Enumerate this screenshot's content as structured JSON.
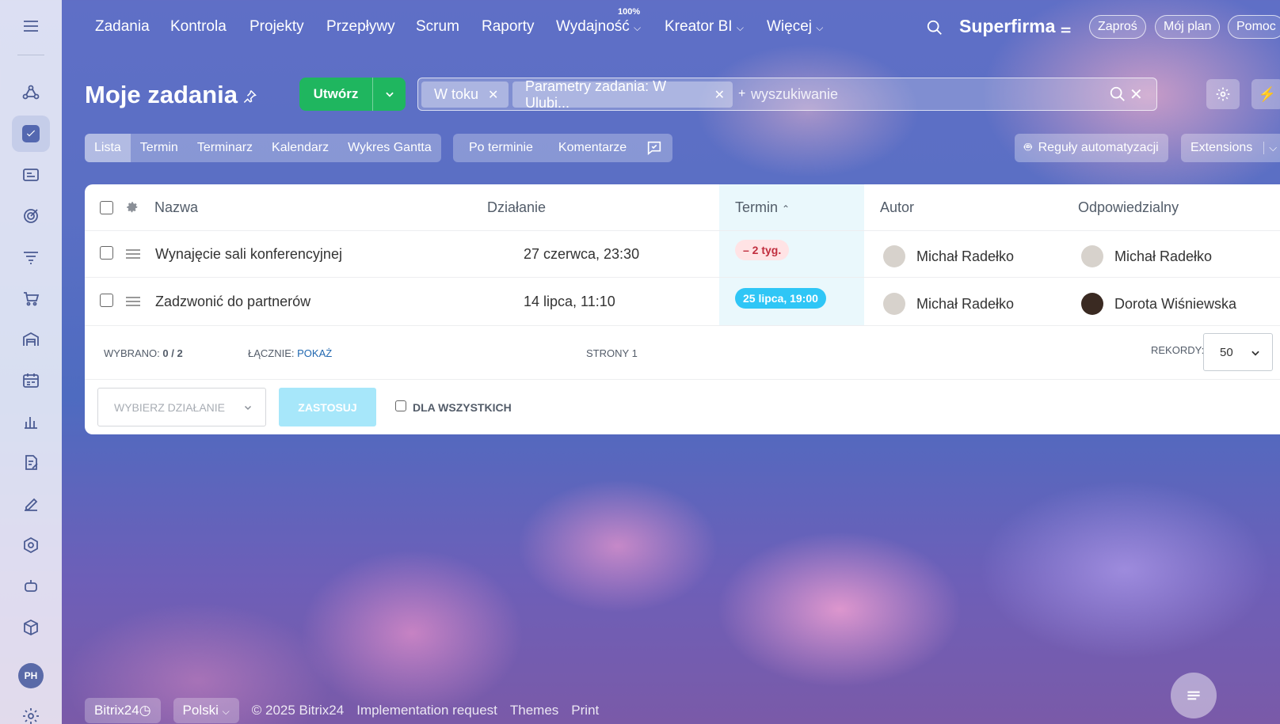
{
  "app": {
    "brand": "Superfirma"
  },
  "topnav": {
    "items": [
      "Zadania",
      "Kontrola",
      "Projekty",
      "Przepływy",
      "Scrum",
      "Raporty",
      "Wydajność",
      "Kreator BI",
      "Więcej"
    ],
    "efficiency_pct": "100%",
    "buttons": [
      "Zaproś",
      "Mój plan",
      "Pomoc"
    ]
  },
  "sidebar": {
    "icons": [
      "menu-icon",
      "crm-icon",
      "tasks-icon",
      "contact-center-icon",
      "marketing-target-icon",
      "funnel-icon",
      "shop-icon",
      "warehouse-icon",
      "calendar-icon",
      "analytics-icon",
      "documents-icon",
      "sign-icon",
      "automation-icon",
      "robot-icon",
      "box-icon",
      "settings-icon"
    ],
    "user_initials": "PH"
  },
  "page": {
    "title": "Moje zadania",
    "create_label": "Utwórz"
  },
  "search": {
    "chips": [
      "W toku",
      "Parametry zadania: W Ulubi..."
    ],
    "placeholder": "wyszukiwanie",
    "plus": "+"
  },
  "views": {
    "tabs": [
      "Lista",
      "Termin",
      "Terminarz",
      "Kalendarz",
      "Wykres Gantta"
    ],
    "active": "Lista",
    "filters": [
      "Po terminie",
      "Komentarze"
    ]
  },
  "toolbar": {
    "rules": "Reguły automatyzacji",
    "extensions": "Extensions"
  },
  "table": {
    "headers": {
      "name": "Nazwa",
      "activity": "Działanie",
      "deadline": "Termin",
      "author": "Autor",
      "responsible": "Odpowiedzialny"
    },
    "rows": [
      {
        "name": "Wynajęcie sali konferencyjnej",
        "activity": "27 czerwca, 23:30",
        "deadline": "– 2 tyg.",
        "deadline_status": "overdue",
        "author": "Michał Radełko",
        "responsible": "Michał Radełko"
      },
      {
        "name": "Zadzwonić do partnerów",
        "activity": "14 lipca, 11:10",
        "deadline": "25 lipca, 19:00",
        "deadline_status": "upcoming",
        "author": "Michał Radełko",
        "responsible": "Dorota Wiśniewska"
      }
    ]
  },
  "footer_stats": {
    "selected_label": "WYBRANO:",
    "selected_value": "0 / 2",
    "total_label": "ŁĄCZNIE:",
    "total_link": "POKAŻ",
    "pages_label": "STRONY",
    "pages_value": "1",
    "records_label": "REKORDY:",
    "records_value": "50"
  },
  "actions": {
    "select_placeholder": "WYBIERZ DZIAŁANIE",
    "apply": "ZASTOSUJ",
    "for_all": "DLA WSZYSTKICH"
  },
  "footer": {
    "bitrix": "Bitrix24",
    "language": "Polski",
    "copyright": "© 2025 Bitrix24",
    "links": [
      "Implementation request",
      "Themes",
      "Print"
    ]
  },
  "colors": {
    "accent_green": "#1fb65f",
    "overdue_bg": "#ffe3e5",
    "overdue_text": "#c02d3e",
    "upcoming_bg": "#2fc6f6",
    "link": "#2067b0"
  }
}
